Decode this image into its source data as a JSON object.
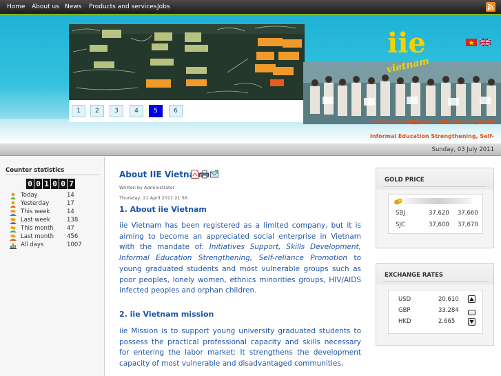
{
  "nav": {
    "items": [
      "Home",
      "About us",
      "News",
      "Products and services",
      "Jobs"
    ],
    "rss_icon": "rss-icon"
  },
  "header": {
    "logo_text": "iie",
    "logo_subtext": "vietnam",
    "tagline_1": "Initiatives Support, Skills Development",
    "tagline_2": "Informal Education Strengthening, Self-",
    "pager": [
      "1",
      "2",
      "3",
      "4",
      "5",
      "6"
    ],
    "pager_active": "5",
    "flags": [
      "vietnam-flag-icon",
      "uk-flag-icon"
    ]
  },
  "datebar": {
    "date": "Sunday, 03 July 2011"
  },
  "counter": {
    "title": "Counter statistics",
    "digits": [
      "0",
      "0",
      "1",
      "0",
      "0",
      "7"
    ],
    "rows": [
      {
        "label": "Today",
        "value": "14"
      },
      {
        "label": "Yesterday",
        "value": "17"
      },
      {
        "label": "This week",
        "value": "14"
      },
      {
        "label": "Last week",
        "value": "138"
      },
      {
        "label": "This month",
        "value": "47"
      },
      {
        "label": "Last month",
        "value": "456"
      },
      {
        "label": "All days",
        "value": "1007"
      }
    ]
  },
  "article": {
    "title": "About IIE Vietnam",
    "author": "Written by Administrator",
    "date": "Thursday, 21 April 2011 21:56",
    "h1": "1. About iie Vietnam",
    "p1_a": "iie Vietnam has been registered as a limited company, but it is aiming to become an appreciated social enterprise in Vietnam with the mandate of: ",
    "p1_em": "Initiatives Support, Skills Development, Informal Education Strengthening, Self-reliance Promotion",
    "p1_b": " to young graduated students and most vulnerable groups such as poor peoples, lonely women, ethnics minorities groups, HIV/AIDS infected peoples and orphan children.",
    "h2": "2. iie Vietnam mission",
    "p2": "iie Mission is to support young university graduated students to possess the practical professional capacity and skills necessary for entering the labor market; It strengthens the development capacity of most vulnerable and disadvantaged communities,"
  },
  "gold": {
    "title": "GOLD PRICE",
    "rows": [
      {
        "name": "SBJ",
        "buy": "37,620",
        "sell": "37,660"
      },
      {
        "name": "SJC",
        "buy": "37,600",
        "sell": "37,670"
      }
    ]
  },
  "exchange": {
    "title": "EXCHANGE RATES",
    "rows": [
      {
        "currency": "USD",
        "rate": "20.610"
      },
      {
        "currency": "GBP",
        "rate": "33.284"
      },
      {
        "currency": "HKD",
        "rate": "2.665"
      }
    ]
  },
  "colors": {
    "accent_green": "#7ab82a",
    "link_blue": "#1a52a6",
    "header_cyan": "#1fb2d6",
    "active_page": "#0000e6",
    "tagline_orange": "#e0501a"
  }
}
